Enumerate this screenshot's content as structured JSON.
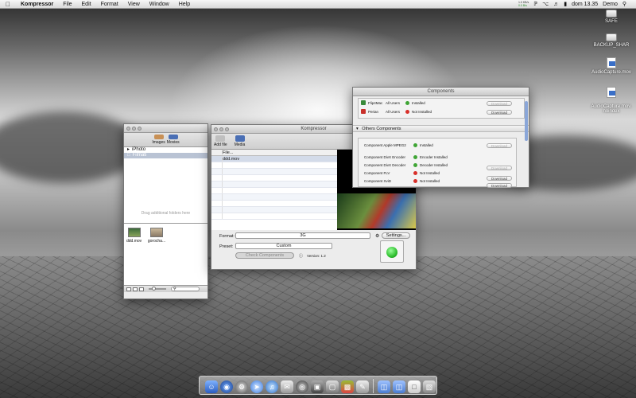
{
  "menubar": {
    "apple": "",
    "app_name": "Kompressor",
    "menus": [
      "File",
      "Edit",
      "Format",
      "View",
      "Window",
      "Help"
    ],
    "meter_top": "1.0 KB/s",
    "meter_bottom": "0.0 B/s",
    "clock": "dom 13.35",
    "user": "Demo"
  },
  "desktop_icons": [
    {
      "label": "SAFE"
    },
    {
      "label": "BACKUP_SHAR"
    },
    {
      "label": "AudioCapture.mov"
    },
    {
      "label": "AudioCapture.mov.\nnoindex"
    }
  ],
  "browser": {
    "tabs": [
      "Images",
      "Movies"
    ],
    "sources": [
      "iPhoto",
      "Filmati"
    ],
    "drop_hint": "Drag additional folders here",
    "files": [
      {
        "name": "ddd.mov"
      },
      {
        "name": "gorocha..."
      }
    ]
  },
  "kompressor": {
    "title": "Kompressor",
    "toolbar": {
      "add_file": "Add file",
      "media": "Media"
    },
    "list_header": "File...",
    "files": [
      "ddd.mov"
    ],
    "format_label": "Format:",
    "format_value": "3G",
    "settings_label": "Settings...",
    "preset_label": "Preset:",
    "preset_value": "Custom",
    "check_label": "Check Components",
    "version": "Version: 1.2"
  },
  "components": {
    "title": "Components",
    "top_rows": [
      {
        "name": "Flip4Mac",
        "scope": "All Users",
        "status": "Installed",
        "ok": true,
        "button": "Download"
      },
      {
        "name": "Perian",
        "scope": "All Users",
        "status": "Not Installed",
        "ok": false,
        "button": "Download"
      }
    ],
    "others_title": "Others Components",
    "rows": [
      {
        "name": "Component Apple MPEG2",
        "status": "Installed",
        "ok": true,
        "button": "Download"
      },
      {
        "name": "Component DivX Encoder",
        "status": "Encoder Installed",
        "ok": true,
        "button": "Download"
      },
      {
        "name": "Component DivX Decoder",
        "status": "Decoder Installed",
        "ok": true,
        "button": "Download"
      },
      {
        "name": "Component FLV",
        "status": "Not Installed",
        "ok": false,
        "button": "Download"
      },
      {
        "name": "Component XviD",
        "status": "Not Installed",
        "ok": false,
        "button": "Download"
      }
    ]
  },
  "colors": {
    "ok": "#3fa535",
    "err": "#d8302a",
    "go": "#2fbf2f"
  }
}
